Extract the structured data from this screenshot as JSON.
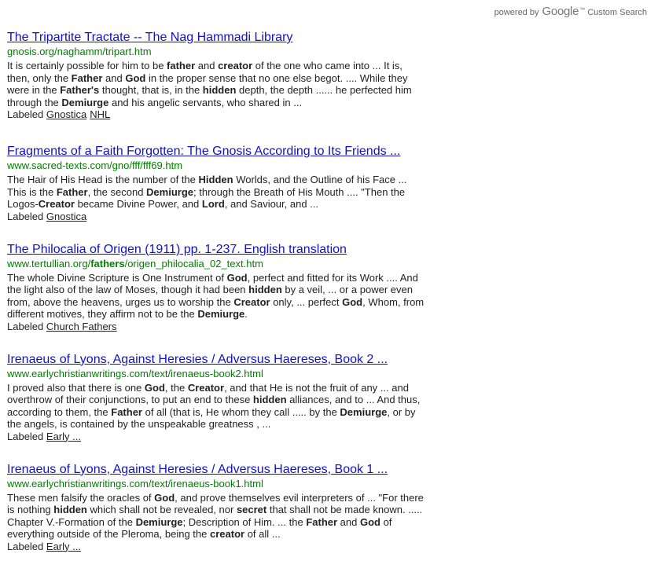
{
  "branding": {
    "powered_by": "powered by",
    "google": "Google",
    "tm": "™",
    "custom_search": "Custom Search"
  },
  "labels_prefix": "Labeled",
  "results": [
    {
      "title": "The Tripartite Tractate -- The Nag Hammadi Library",
      "url": "gnosis.org/naghamm/tripart.htm",
      "snippet": "It is certainly possible for him to be <b>father</b> and <b>creator</b> of the one who came into ... It is, then, only the <b>Father</b> and <b>God</b> in the proper sense that no one else begot. .... While they were in the <b>Father's</b> thought, that is, in the <b>hidden</b> depth, the depth ...... he perfected him through the <b>Demiurge</b> and his angelic servants, who shared in ...",
      "labels": [
        "Gnostica",
        "NHL"
      ]
    },
    {
      "title": "Fragments of a Faith Forgotten: The Gnosis According to Its Friends ...",
      "url": "www.sacred-texts.com/gno/fff/fff69.htm",
      "snippet": "The Hair of His Head is the number of the <b>Hidden</b> Worlds, and the Outline of his Face ... This is the <b>Father</b>, the second <b>Demiurge</b>; through the Breath of His Mouth .... \"Then the Logos-<b>Creator</b> became Divine Power, and <b>Lord</b>, and Saviour, and ...",
      "labels": [
        "Gnostica"
      ]
    },
    {
      "title": "The Philocalia of Origen (1911) pp. 1-237. English translation",
      "url": "www.tertullian.org/<b>fathers</b>/origen_philocalia_02_text.htm",
      "snippet": "The whole Divine Scripture is One Instrument of <b>God</b>, perfect and fitted for its Work .... And the light also of the law of Moses, though it had been <b>hidden</b> by a veil, ... or a power even from, above the heavens, urges us to worship the <b>Creator</b> only, ... perfect <b>God</b>, Whom, from different motives, they affirm not to be the <b>Demiurge</b>.",
      "labels": [
        "Church Fathers"
      ]
    },
    {
      "title": "Irenaeus of Lyons, Against Heresies / Adversus Haereses, Book 2 ...",
      "url": "www.earlychristianwritings.com/text/irenaeus-book2.html",
      "snippet": "I proved also that there is one <b>God</b>, the <b>Creator</b>, and that He is not the fruit of any ... and overthrow of their conjunctions, to put an end to these <b>hidden</b> alliances, and to ... And thus, according to them, the <b>Father</b> of all (that is, He whom they call ..... by the <b>Demiurge</b>, or by the angels, is contained by the unspeakable greatness , ...",
      "labels": [
        "Early ..."
      ]
    },
    {
      "title": "Irenaeus of Lyons, Against Heresies / Adversus Haereses, Book 1 ...",
      "url": "www.earlychristianwritings.com/text/irenaeus-book1.html",
      "snippet": "These men falsify the oracles of <b>God</b>, and prove themselves evil interpreters of ... \"For there is nothing <b>hidden</b> which shall not be revealed, nor <b>secret</b> that shall not be made known. ..... Chapter V.-Formation of the <b>Demiurge</b>; Description of Him. ... the <b>Father</b> and <b>God</b> of everything outside of the Pleroma, being the <b>creator</b> of all ...",
      "labels": [
        "Early ..."
      ]
    }
  ]
}
